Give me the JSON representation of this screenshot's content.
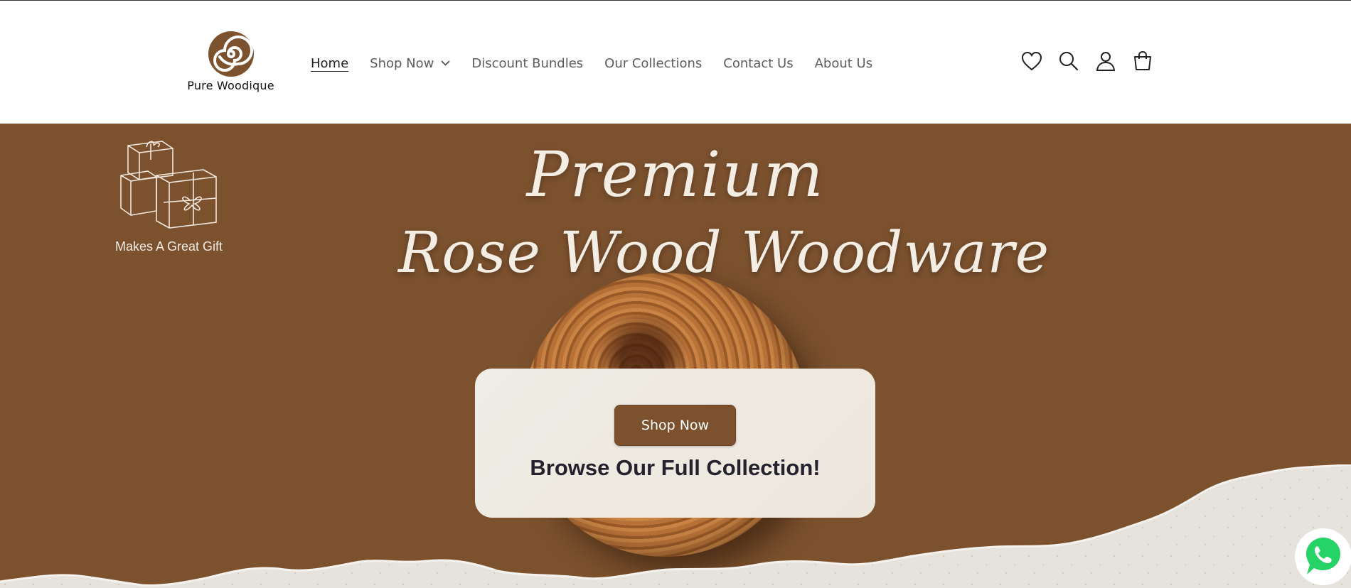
{
  "brand": {
    "name": "Pure Woodique",
    "color": "#7b512e"
  },
  "nav": {
    "items": [
      {
        "label": "Home",
        "active": true
      },
      {
        "label": "Shop Now",
        "dropdown": true
      },
      {
        "label": "Discount Bundles"
      },
      {
        "label": "Our Collections"
      },
      {
        "label": "Contact Us"
      },
      {
        "label": "About Us"
      }
    ]
  },
  "header_icons": [
    "heart-icon",
    "search-icon",
    "account-icon",
    "cart-icon"
  ],
  "hero": {
    "gift_label": "Makes A Great Gift",
    "title_line1": "Premium",
    "title_line2": "Rose Wood Woodware",
    "cta_label": "Shop Now",
    "subtitle": "Browse Our Full Collection!",
    "background_color": "#7b512e",
    "text_color": "#f4ede4"
  },
  "floating": {
    "icon": "whatsapp-icon",
    "color": "#25d366"
  }
}
